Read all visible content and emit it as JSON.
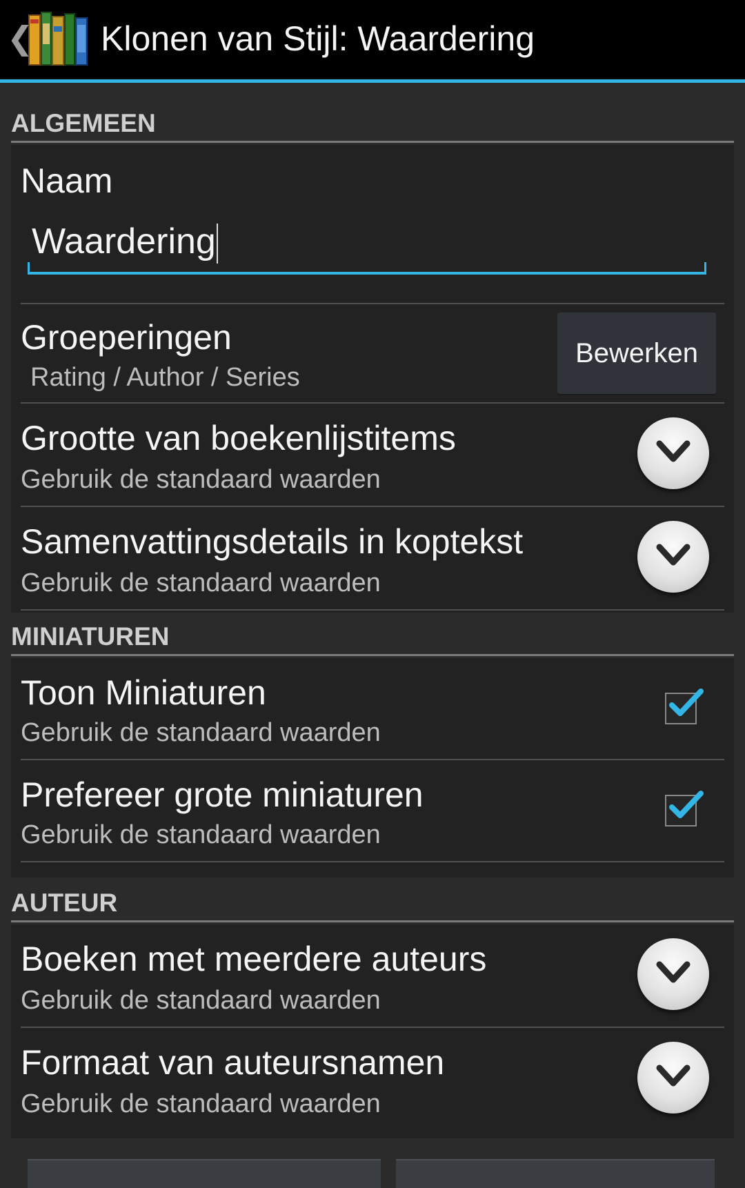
{
  "appbar": {
    "title": "Klonen van Stijl: Waardering",
    "up_icon": "chevron-left-icon",
    "app_icon": "bookshelf-icon"
  },
  "colors": {
    "accent": "#33b5e5",
    "background": "#2b2b2b",
    "panel": "#222222"
  },
  "sections": {
    "general": {
      "header": "ALGEMEEN",
      "name_label": "Naam",
      "name_value": "Waardering",
      "groupings_title": "Groeperingen",
      "groupings_value": "Rating / Author / Series",
      "edit_button": "Bewerken",
      "item_size_title": "Grootte van boekenlijstitems",
      "item_size_value": "Gebruik de standaard waarden",
      "summary_title": "Samenvattingsdetails in koptekst",
      "summary_value": "Gebruik de standaard waarden"
    },
    "thumbnails": {
      "header": "MINIATUREN",
      "show_title": "Toon Miniaturen",
      "show_value": "Gebruik de standaard waarden",
      "show_checked": true,
      "large_title": "Prefereer grote miniaturen",
      "large_value": "Gebruik de standaard waarden",
      "large_checked": true
    },
    "author": {
      "header": "AUTEUR",
      "multi_title": "Boeken met meerdere auteurs",
      "multi_value": "Gebruik de standaard waarden",
      "format_title": "Formaat van auteursnamen",
      "format_value": "Gebruik de standaard waarden"
    }
  }
}
